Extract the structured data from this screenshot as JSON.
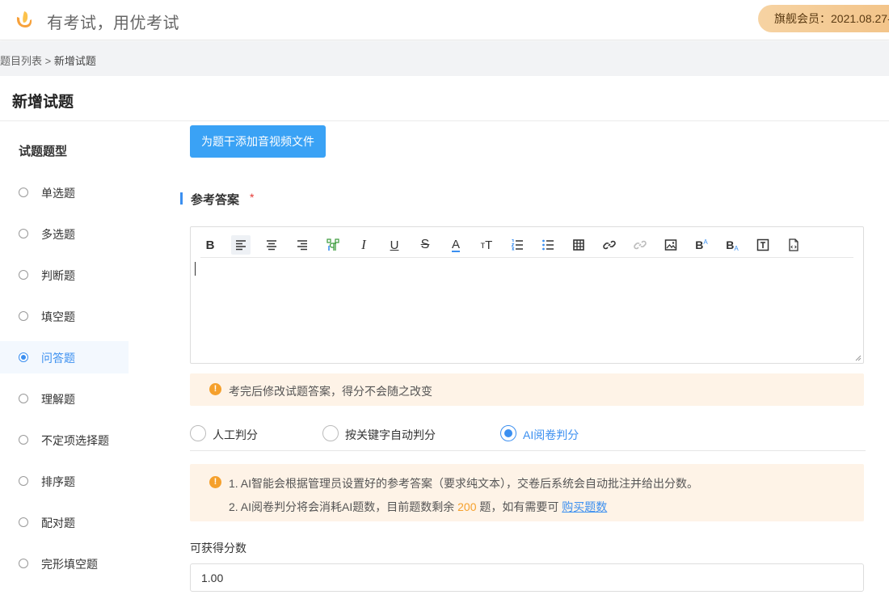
{
  "header": {
    "brand_text": "有考试，用优考试",
    "member_label": "旗舰会员：2021.08.27-"
  },
  "breadcrumb": {
    "parent": "题目列表",
    "separator": ">",
    "current": "新增试题"
  },
  "page": {
    "title": "新增试题"
  },
  "sidebar": {
    "heading": "试题题型",
    "active_index": 4,
    "items": [
      {
        "label": "单选题"
      },
      {
        "label": "多选题"
      },
      {
        "label": "判断题"
      },
      {
        "label": "填空题"
      },
      {
        "label": "问答题"
      },
      {
        "label": "理解题"
      },
      {
        "label": "不定项选择题"
      },
      {
        "label": "排序题"
      },
      {
        "label": "配对题"
      },
      {
        "label": "完形填空题"
      }
    ]
  },
  "main": {
    "add_media_button": "为题干添加音视频文件",
    "answer_section_title": "参考答案",
    "required_mark": "*",
    "editor_toolbar": [
      {
        "icon": "bold-icon",
        "glyph": "B"
      },
      {
        "icon": "align-left-icon"
      },
      {
        "icon": "align-center-icon"
      },
      {
        "icon": "align-right-icon"
      },
      {
        "icon": "format-paragraph-icon"
      },
      {
        "icon": "italic-icon",
        "glyph": "I"
      },
      {
        "icon": "underline-icon",
        "glyph": "U"
      },
      {
        "icon": "strikethrough-icon",
        "glyph": "S"
      },
      {
        "icon": "font-color-icon",
        "glyph": "A"
      },
      {
        "icon": "font-size-icon",
        "glyph": "тT"
      },
      {
        "icon": "ordered-list-icon"
      },
      {
        "icon": "unordered-list-icon"
      },
      {
        "icon": "table-icon"
      },
      {
        "icon": "link-icon"
      },
      {
        "icon": "unlink-icon"
      },
      {
        "icon": "image-icon"
      },
      {
        "icon": "superscript-icon",
        "glyph": "B"
      },
      {
        "icon": "subscript-icon",
        "glyph": "B"
      },
      {
        "icon": "text-box-icon",
        "glyph": "T"
      },
      {
        "icon": "file-code-icon"
      }
    ],
    "notice_answer_change": "考完后修改试题答案，得分不会随之改变",
    "grading_options": [
      {
        "label": "人工判分",
        "selected": false
      },
      {
        "label": "按关键字自动判分",
        "selected": false
      },
      {
        "label": "AI阅卷判分",
        "selected": true
      }
    ],
    "ai_notice": {
      "line1": "1. AI智能会根据管理员设置好的参考答案（要求纯文本），交卷后系统会自动批注并给出分数。",
      "line2_prefix": "2. AI阅卷判分将会消耗AI题数，目前题数剩余",
      "remaining": "200",
      "line2_suffix": "题，如有需要可",
      "buy_link": "购买题数"
    },
    "score_label": "可获得分数",
    "score_value": "1.00"
  },
  "colors": {
    "accent": "#3b8ff0",
    "button": "#3aa2f5",
    "warning": "#f5a02c",
    "notice_bg": "#fef3e7"
  }
}
